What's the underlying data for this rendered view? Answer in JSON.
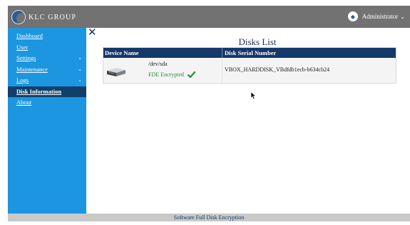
{
  "header": {
    "brand": "KLC GROUP",
    "user": "Administrator"
  },
  "sidebar": {
    "items": [
      {
        "label": "Dashboard",
        "has_arrow": false,
        "active": false
      },
      {
        "label": "User",
        "has_arrow": false,
        "active": false
      },
      {
        "label": "Settings",
        "has_arrow": true,
        "active": false
      },
      {
        "label": "Maintenance",
        "has_arrow": true,
        "active": false
      },
      {
        "label": "Logs",
        "has_arrow": true,
        "active": false
      },
      {
        "label": "Disk Information",
        "has_arrow": false,
        "active": true
      },
      {
        "label": "About",
        "has_arrow": false,
        "active": false
      }
    ]
  },
  "main": {
    "close_symbol": "✕",
    "title": "Disks List",
    "table": {
      "headers": [
        "Device Name",
        "Disk Serial Number"
      ],
      "rows": [
        {
          "device": "/dev/sda",
          "status": "FDE Encrypted",
          "serial": "VBOX_HARDDISK_VBdfdb1ecb-b634cb24"
        }
      ]
    }
  },
  "footer": {
    "text": "Software Full Disk Encryption"
  },
  "colors": {
    "topbar": "#727272",
    "sidebar": "#1c96e0",
    "sidebar_active": "#113f6b",
    "table_header": "#15386a",
    "encrypted": "#2f8d2f"
  },
  "icons": [
    "logo-icon",
    "user-shield-icon",
    "chevron-down-icon",
    "close-icon",
    "hard-disk-icon",
    "checkmark-icon",
    "mouse-pointer-icon"
  ]
}
